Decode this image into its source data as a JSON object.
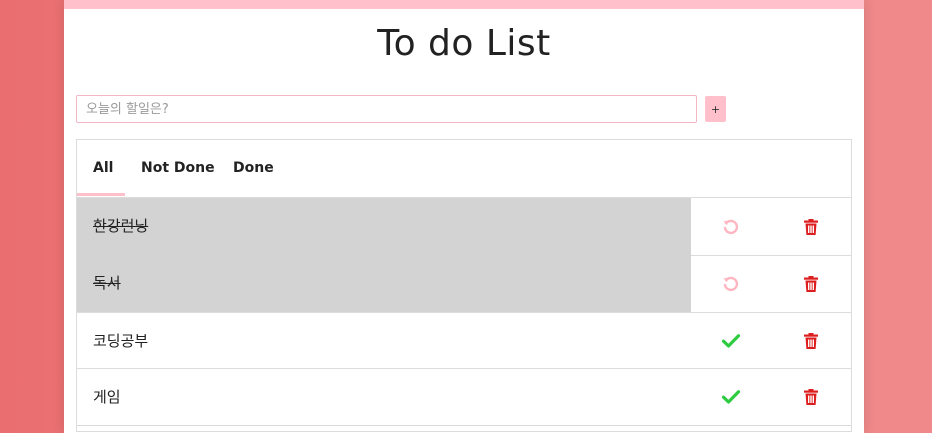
{
  "title": "To do List",
  "input": {
    "placeholder": "오늘의 할일은?",
    "value": ""
  },
  "add_button_label": "+",
  "tabs": [
    {
      "label": "All",
      "active": true
    },
    {
      "label": "Not Done",
      "active": false
    },
    {
      "label": "Done",
      "active": false
    }
  ],
  "tasks": [
    {
      "text": "한강런닝",
      "done": true,
      "action_icon": "undo-icon",
      "delete_icon": "trash-icon"
    },
    {
      "text": "독서",
      "done": true,
      "action_icon": "undo-icon",
      "delete_icon": "trash-icon"
    },
    {
      "text": "코딩공부",
      "done": false,
      "action_icon": "check-icon",
      "delete_icon": "trash-icon"
    },
    {
      "text": "게임",
      "done": false,
      "action_icon": "check-icon",
      "delete_icon": "trash-icon"
    }
  ],
  "colors": {
    "accent": "#ffc0cb",
    "background": "#ee7b7b",
    "check": "#2ecc40",
    "delete": "#dc1e1e",
    "undo": "#ffb6c1",
    "done_row": "#d3d3d3"
  }
}
